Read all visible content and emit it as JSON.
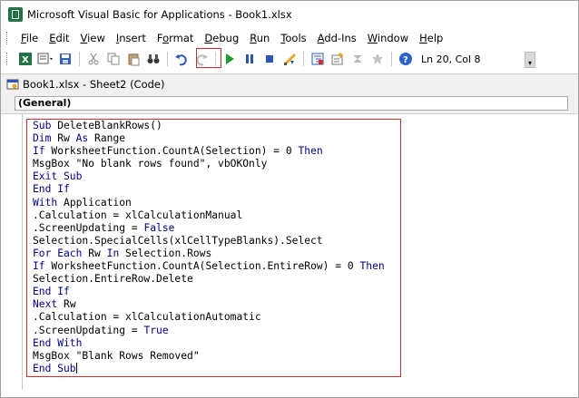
{
  "window": {
    "title": "Microsoft Visual Basic for Applications - Book1.xlsx"
  },
  "menubar": {
    "items": [
      {
        "label": "File",
        "u": "F",
        "rest": "ile"
      },
      {
        "label": "Edit",
        "u": "E",
        "rest": "dit"
      },
      {
        "label": "View",
        "u": "V",
        "rest": "iew"
      },
      {
        "label": "Insert",
        "u": "I",
        "rest": "nsert"
      },
      {
        "label": "Format",
        "pre": "F",
        "u": "o",
        "rest": "rmat"
      },
      {
        "label": "Debug",
        "u": "D",
        "rest": "ebug"
      },
      {
        "label": "Run",
        "u": "R",
        "rest": "un"
      },
      {
        "label": "Tools",
        "u": "T",
        "rest": "ools"
      },
      {
        "label": "Add-Ins",
        "u": "A",
        "rest": "dd-Ins"
      },
      {
        "label": "Window",
        "u": "W",
        "rest": "indow"
      },
      {
        "label": "Help",
        "u": "H",
        "rest": "elp"
      }
    ]
  },
  "toolbar": {
    "status": "Ln 20, Col 8",
    "highlighted_button": "run-sub-button"
  },
  "code_window": {
    "title": "Book1.xlsx - Sheet2 (Code)",
    "object_dropdown": "(General)"
  },
  "code": {
    "lines": [
      [
        {
          "t": "Sub",
          "k": 1
        },
        {
          "t": " DeleteBlankRows()"
        }
      ],
      [
        {
          "t": "Dim",
          "k": 1
        },
        {
          "t": " Rw "
        },
        {
          "t": "As",
          "k": 1
        },
        {
          "t": " Range"
        }
      ],
      [
        {
          "t": "If",
          "k": 1
        },
        {
          "t": " WorksheetFunction.CountA(Selection) = 0 "
        },
        {
          "t": "Then",
          "k": 1
        }
      ],
      [
        {
          "t": "MsgBox \"No blank rows found\", vbOKOnly"
        }
      ],
      [
        {
          "t": "Exit Sub",
          "k": 1
        }
      ],
      [
        {
          "t": "End If",
          "k": 1
        }
      ],
      [
        {
          "t": "With",
          "k": 1
        },
        {
          "t": " Application"
        }
      ],
      [
        {
          "t": ".Calculation = xlCalculationManual"
        }
      ],
      [
        {
          "t": ".ScreenUpdating = "
        },
        {
          "t": "False",
          "k": 1
        }
      ],
      [
        {
          "t": "Selection.SpecialCells(xlCellTypeBlanks).Select"
        }
      ],
      [
        {
          "t": "For Each",
          "k": 1
        },
        {
          "t": " Rw "
        },
        {
          "t": "In",
          "k": 1
        },
        {
          "t": " Selection.Rows"
        }
      ],
      [
        {
          "t": "If",
          "k": 1
        },
        {
          "t": " WorksheetFunction.CountA(Selection.EntireRow) = 0 "
        },
        {
          "t": "Then",
          "k": 1
        }
      ],
      [
        {
          "t": "Selection.EntireRow.Delete"
        }
      ],
      [
        {
          "t": "End If",
          "k": 1
        }
      ],
      [
        {
          "t": "Next",
          "k": 1
        },
        {
          "t": " Rw"
        }
      ],
      [
        {
          "t": ".Calculation = xlCalculationAutomatic"
        }
      ],
      [
        {
          "t": ".ScreenUpdating = "
        },
        {
          "t": "True",
          "k": 1
        }
      ],
      [
        {
          "t": "End With",
          "k": 1
        }
      ],
      [
        {
          "t": "MsgBox \"Blank Rows Removed\""
        }
      ],
      [
        {
          "t": "End Sub",
          "k": 1
        }
      ]
    ]
  },
  "colors": {
    "keyword": "#00008b",
    "highlight_border": "#d42a2a",
    "excel_green": "#217346"
  }
}
